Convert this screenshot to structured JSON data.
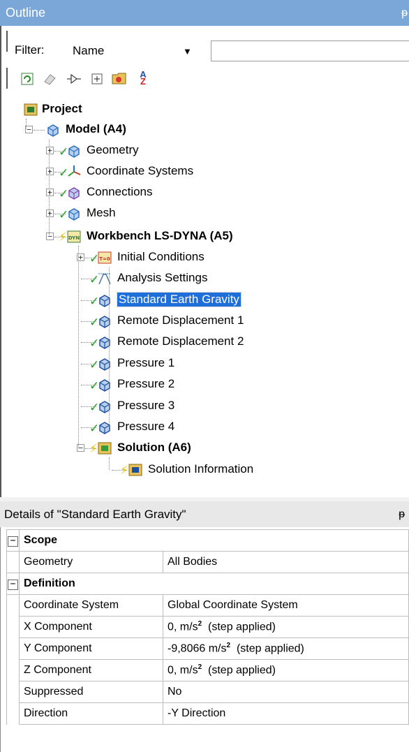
{
  "outline": {
    "title": "Outline",
    "pin": "ᵽ",
    "filter_label": "Filter:",
    "filter_value": "Name",
    "filter_arrow": "▼",
    "toolbar_sort_icon": "A↓Z"
  },
  "tree": [
    {
      "label": "Project",
      "bold": true,
      "icon": "project-icon"
    },
    {
      "label": "Model (A4)",
      "bold": true,
      "icon": "model-icon"
    },
    {
      "label": "Geometry",
      "bold": false,
      "icon": "geometry-icon"
    },
    {
      "label": "Coordinate Systems",
      "bold": false,
      "icon": "coordinate-systems-icon"
    },
    {
      "label": "Connections",
      "bold": false,
      "icon": "connections-icon"
    },
    {
      "label": "Mesh",
      "bold": false,
      "icon": "mesh-icon"
    },
    {
      "label": "Workbench LS-DYNA (A5)",
      "bold": true,
      "icon": "lsdyna-icon",
      "icon_text": "DYN"
    },
    {
      "label": "Initial Conditions",
      "bold": false,
      "icon": "initial-conditions-icon",
      "icon_text": "T=0"
    },
    {
      "label": "Analysis Settings",
      "bold": false,
      "icon": "analysis-settings-icon"
    },
    {
      "label": "Standard Earth Gravity",
      "bold": false,
      "icon": "gravity-icon",
      "selected": true
    },
    {
      "label": "Remote Displacement 1",
      "bold": false,
      "icon": "remote-displacement-icon"
    },
    {
      "label": "Remote Displacement 2",
      "bold": false,
      "icon": "remote-displacement-icon"
    },
    {
      "label": "Pressure 1",
      "bold": false,
      "icon": "pressure-icon"
    },
    {
      "label": "Pressure 2",
      "bold": false,
      "icon": "pressure-icon"
    },
    {
      "label": "Pressure 3",
      "bold": false,
      "icon": "pressure-icon"
    },
    {
      "label": "Pressure 4",
      "bold": false,
      "icon": "pressure-icon"
    },
    {
      "label": "Solution (A6)",
      "bold": true,
      "icon": "solution-icon"
    },
    {
      "label": "Solution Information",
      "bold": false,
      "icon": "solution-information-icon"
    }
  ],
  "details": {
    "title": "Details of \"Standard Earth Gravity\"",
    "pin": "ᵽ",
    "sections": [
      {
        "name": "Scope",
        "rows": [
          {
            "key": "Geometry",
            "value": "All Bodies"
          }
        ]
      },
      {
        "name": "Definition",
        "rows": [
          {
            "key": "Coordinate System",
            "value": "Global Coordinate System"
          },
          {
            "key": "X Component",
            "value": "0, m/s",
            "sup": "2",
            "suffix": "  (step applied)"
          },
          {
            "key": "Y Component",
            "value": "-9,8066 m/s",
            "sup": "2",
            "suffix": "  (step applied)"
          },
          {
            "key": "Z Component",
            "value": "0, m/s",
            "sup": "2",
            "suffix": "  (step applied)"
          },
          {
            "key": "Suppressed",
            "value": "No"
          },
          {
            "key": "Direction",
            "value": "-Y Direction"
          }
        ]
      }
    ]
  }
}
